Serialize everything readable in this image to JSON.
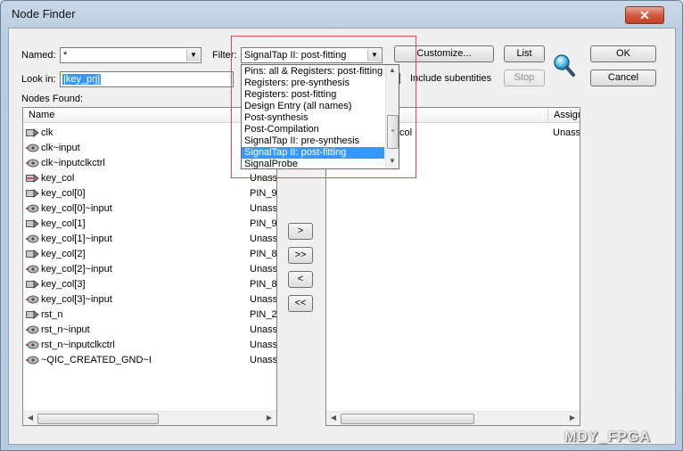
{
  "window": {
    "title": "Node Finder",
    "close_glyph": "✕"
  },
  "named": {
    "label": "Named:",
    "value": "*"
  },
  "filter": {
    "label": "Filter:",
    "value": "SignalTap II: post-fitting"
  },
  "buttons": {
    "customize": "Customize...",
    "list": "List",
    "stop": "Stop",
    "ok": "OK",
    "cancel": "Cancel",
    "add_one": ">",
    "add_all": ">>",
    "remove_one": "<",
    "remove_all": "<<"
  },
  "look_in": {
    "label": "Look in:",
    "value": "|key_prj|"
  },
  "include_subentities": {
    "label": "Include subentities",
    "checked": true
  },
  "nodes_found": {
    "label": "Nodes Found:",
    "columns": [
      "Name",
      "Assig"
    ],
    "rows": [
      {
        "name": "clk",
        "loc": ""
      },
      {
        "name": "clk~input",
        "loc": ""
      },
      {
        "name": "clk~inputclkctrl",
        "loc": ""
      },
      {
        "name": "key_col",
        "loc": "Unass"
      },
      {
        "name": "key_col[0]",
        "loc": "PIN_9"
      },
      {
        "name": "key_col[0]~input",
        "loc": "Unass"
      },
      {
        "name": "key_col[1]",
        "loc": "PIN_9"
      },
      {
        "name": "key_col[1]~input",
        "loc": "Unass"
      },
      {
        "name": "key_col[2]",
        "loc": "PIN_8"
      },
      {
        "name": "key_col[2]~input",
        "loc": "Unass"
      },
      {
        "name": "key_col[3]",
        "loc": "PIN_8"
      },
      {
        "name": "key_col[3]~input",
        "loc": "Unass"
      },
      {
        "name": "rst_n",
        "loc": "PIN_2"
      },
      {
        "name": "rst_n~input",
        "loc": "Unass"
      },
      {
        "name": "rst_n~inputclkctrl",
        "loc": "Unass"
      },
      {
        "name": "~QIC_CREATED_GND~I",
        "loc": "Unass"
      }
    ]
  },
  "selected_nodes": {
    "columns": [
      "Assign"
    ],
    "rows": [
      {
        "name": "col",
        "loc": "Unass"
      }
    ]
  },
  "filter_options": [
    "Pins: all & Registers: post-fitting",
    "Registers: pre-synthesis",
    "Registers: post-fitting",
    "Design Entry (all names)",
    "Post-synthesis",
    "Post-Compilation",
    "SignalTap II: pre-synthesis",
    "SignalTap II: post-fitting",
    "SignalProbe"
  ],
  "filter_selected_index": 7,
  "watermark": "MDY_FPGA",
  "colors": {
    "selection": "#3399ff",
    "highlight": "#e64a4a"
  }
}
